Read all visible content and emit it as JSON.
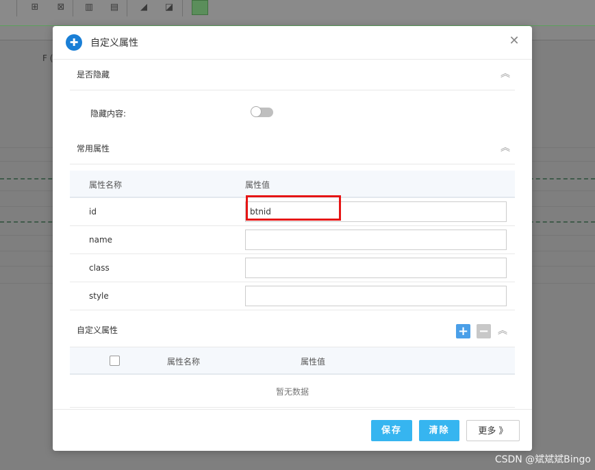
{
  "background": {
    "toolbar_icons": [
      "split-cell-icon",
      "merge-cell-icon",
      "table-columns-icon",
      "table-rows-icon",
      "eraser-icon",
      "format-painter-icon",
      "sheet-icon"
    ],
    "column_header": "F (",
    "watermark": "CSDN @斌斌斌Bingo"
  },
  "dialog": {
    "title": "自定义属性",
    "logo_icon": "app-logo-icon",
    "close_glyph": "✕",
    "sections": {
      "hidden": {
        "title": "是否隐藏",
        "field_label": "隐藏内容:",
        "toggle_on": false
      },
      "common": {
        "title": "常用属性",
        "columns": [
          "属性名称",
          "属性值"
        ],
        "rows": [
          {
            "name": "id",
            "value": "btnid"
          },
          {
            "name": "name",
            "value": ""
          },
          {
            "name": "class",
            "value": ""
          },
          {
            "name": "style",
            "value": ""
          }
        ]
      },
      "custom": {
        "title": "自定义属性",
        "columns": [
          "属性名称",
          "属性值"
        ],
        "empty_text": "暂无数据",
        "add_glyph": "+",
        "remove_glyph": "−"
      }
    },
    "footer": {
      "save": "保存",
      "clear": "清除",
      "more": "更多 》"
    },
    "colors": {
      "primary": "#36b5f0",
      "add_button": "#4a9fe8",
      "remove_button": "#c8c8c8",
      "highlight": "#e61414"
    }
  }
}
